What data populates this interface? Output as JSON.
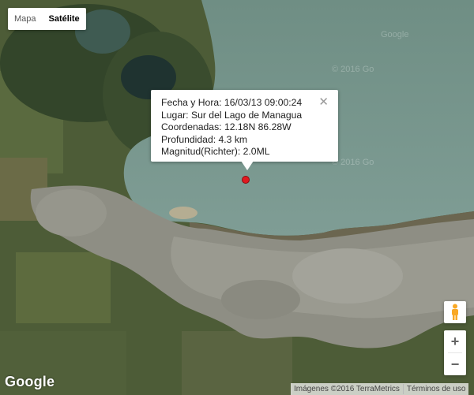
{
  "map_type": {
    "options": [
      "Mapa",
      "Satélite"
    ],
    "selected": "Satélite"
  },
  "info_window": {
    "lines": [
      "Fecha y Hora: 16/03/13 09:00:24",
      "Lugar: Sur del Lago de Managua",
      "Coordenadas: 12.18N 86.28W",
      "Profundidad: 4.3 km",
      "Magnitud(Richter): 2.0ML"
    ],
    "close_glyph": "✕"
  },
  "marker": {
    "color": "#e0191f"
  },
  "controls": {
    "pegman_icon": "pegman-icon",
    "zoom_in": "+",
    "zoom_out": "−"
  },
  "footer": {
    "logo": "Google",
    "attribution": "Imágenes ©2016 TerraMetrics",
    "terms": "Términos de uso"
  },
  "watermarks": [
    "Google",
    "© 2016 Go",
    "© 2016 Go"
  ]
}
